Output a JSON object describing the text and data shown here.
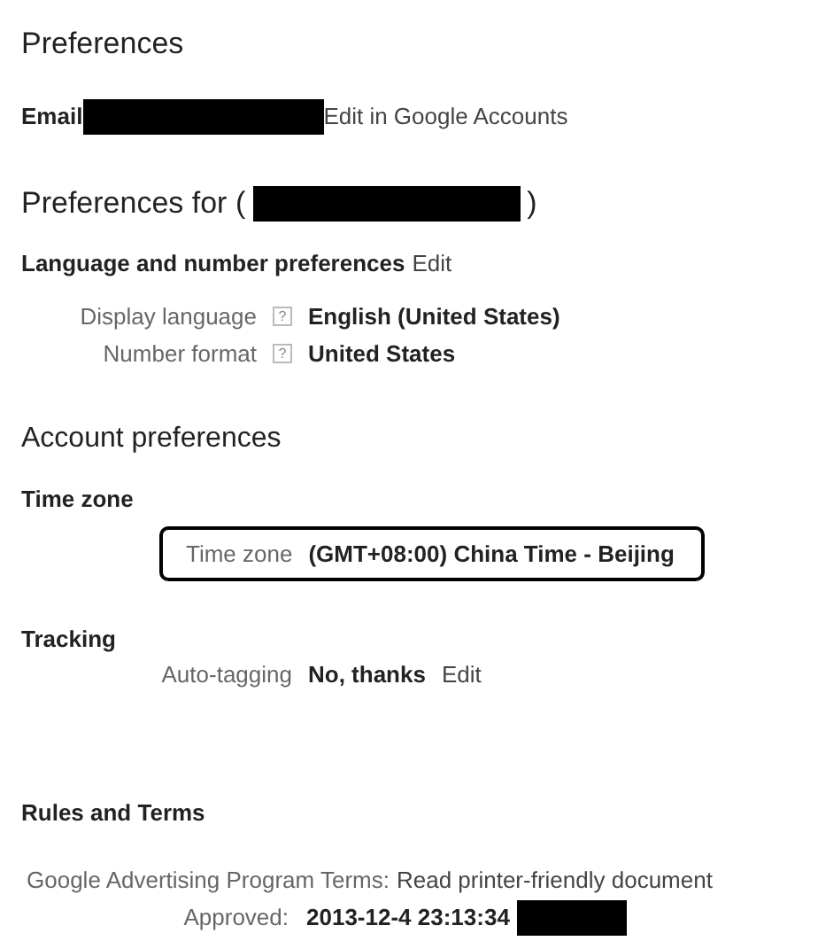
{
  "title": "Preferences",
  "email": {
    "label": "Email",
    "link": "Edit in Google Accounts"
  },
  "preferences_for": {
    "prefix": "Preferences for (",
    "suffix": ")"
  },
  "language": {
    "heading": "Language and number preferences",
    "edit": "Edit",
    "rows": [
      {
        "label": "Display language",
        "help": "?",
        "value": "English (United States)"
      },
      {
        "label": "Number format",
        "help": "?",
        "value": "United States"
      }
    ]
  },
  "account_heading": "Account preferences",
  "time_zone": {
    "heading": "Time zone",
    "label": "Time zone",
    "value": "(GMT+08:00) China Time - Beijing"
  },
  "tracking": {
    "heading": "Tracking",
    "label": "Auto-tagging",
    "value": "No, thanks",
    "edit": "Edit"
  },
  "rules": {
    "heading": "Rules and Terms",
    "terms_label": "Google Advertising Program Terms:",
    "terms_link": "Read printer-friendly document",
    "approved_label": "Approved:",
    "approved_value": "2013-12-4 23:13:34"
  }
}
